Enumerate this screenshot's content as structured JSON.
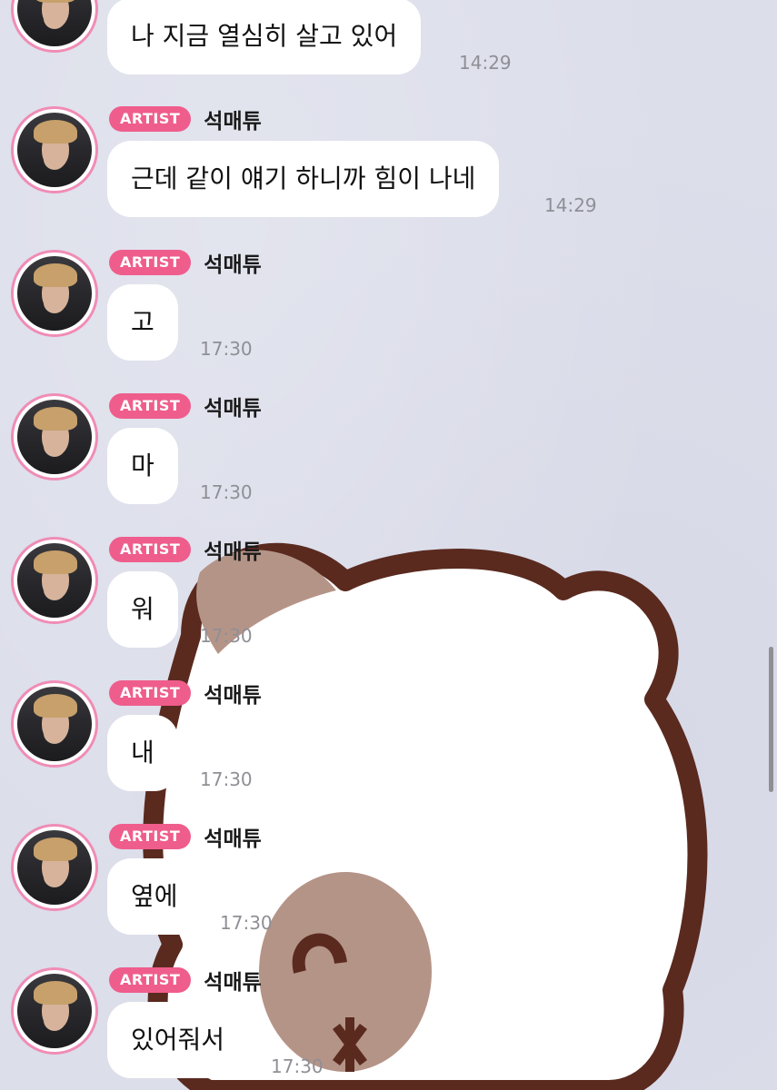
{
  "badge_label": "ARTIST",
  "sender_name": "석매튜",
  "messages": [
    {
      "text": "나 지금 열심히 살고 있어",
      "time": "14:29"
    },
    {
      "text": "근데 같이 얘기 하니까 힘이 나네",
      "time": "14:29"
    },
    {
      "text": "고",
      "time": "17:30"
    },
    {
      "text": "마",
      "time": "17:30"
    },
    {
      "text": "워",
      "time": "17:30"
    },
    {
      "text": "내",
      "time": "17:30"
    },
    {
      "text": "옆에",
      "time": "17:30"
    },
    {
      "text": "있어줘서",
      "time": "17:30"
    }
  ],
  "colors": {
    "badge": "#ef5d8c",
    "avatar_ring": "#f08cb6",
    "bubble": "#ffffff",
    "background": "#dcdeea"
  }
}
